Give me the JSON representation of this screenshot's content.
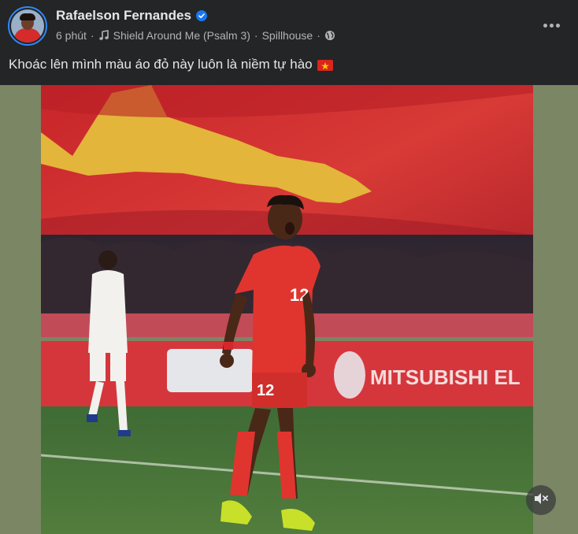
{
  "post": {
    "author": "Rafaelson Fernandes",
    "time": "6 phút",
    "song": "Shield Around Me (Psalm 3)",
    "artist": "Spillhouse",
    "separator": "·",
    "caption": "Khoác lên mình màu áo đỏ này luôn là niềm tự hào",
    "jersey_number": "12",
    "banner_text": "MITSUBISHI EL"
  },
  "icons": {
    "verified": "verified-badge-icon",
    "music": "music-note-icon",
    "privacy": "globe-icon",
    "flag": "vietnam-flag-icon",
    "more": "more-options-icon",
    "mute": "speaker-muted-icon"
  },
  "colors": {
    "background": "#242526",
    "text_primary": "#e4e6eb",
    "text_secondary": "#b0b3b8",
    "accent": "#1877f2",
    "flag_red": "#da251d",
    "flag_yellow": "#ffcd00"
  }
}
